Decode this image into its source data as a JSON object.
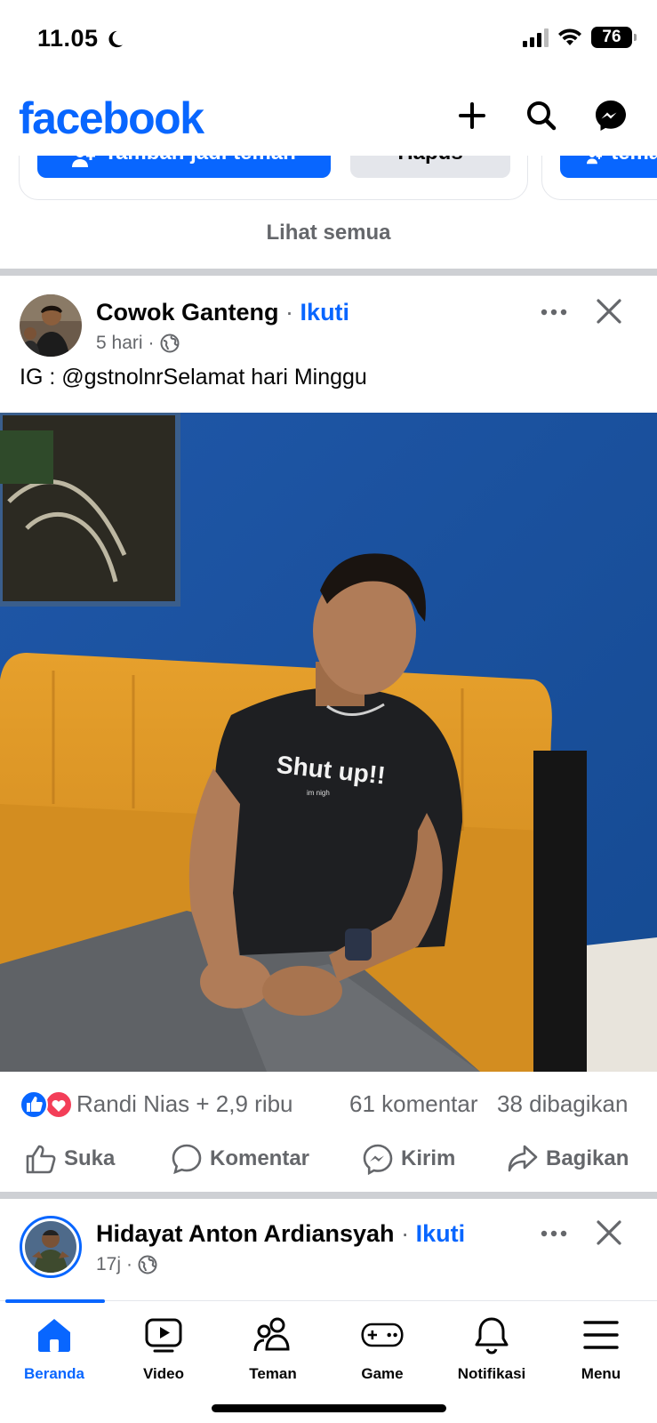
{
  "status_bar": {
    "time": "11.05",
    "battery": "76"
  },
  "header": {
    "logo": "facebook"
  },
  "suggestions": {
    "add_friend_label": "Tambah jadi teman",
    "delete_label": "Hapus",
    "see_all_label": "Lihat semua"
  },
  "post1": {
    "author": "Cowok Ganteng",
    "separator": "·",
    "follow_label": "Ikuti",
    "time": "5 hari",
    "meta_separator": "·",
    "text": "IG : @gstnolnrSelamat hari Minggu",
    "photo_shirt_text": "Shut up!!",
    "photo_shirt_subtext": "im nigh",
    "reactions_text": "Randi Nias + 2,9 ribu",
    "comments_count": "61 komentar",
    "shares_count": "38 dibagikan",
    "actions": {
      "like": "Suka",
      "comment": "Komentar",
      "send": "Kirim",
      "share": "Bagikan"
    }
  },
  "post2": {
    "author": "Hidayat Anton Ardiansyah",
    "separator": "·",
    "follow_label": "Ikuti",
    "time": "17j",
    "meta_separator": "·"
  },
  "bottom_nav": {
    "items": [
      {
        "label": "Beranda",
        "active": true
      },
      {
        "label": "Video"
      },
      {
        "label": "Teman"
      },
      {
        "label": "Game"
      },
      {
        "label": "Notifikasi"
      },
      {
        "label": "Menu"
      }
    ]
  },
  "colors": {
    "brand": "#0866ff",
    "secondary_text": "#65676b",
    "divider": "#ced0d4"
  }
}
